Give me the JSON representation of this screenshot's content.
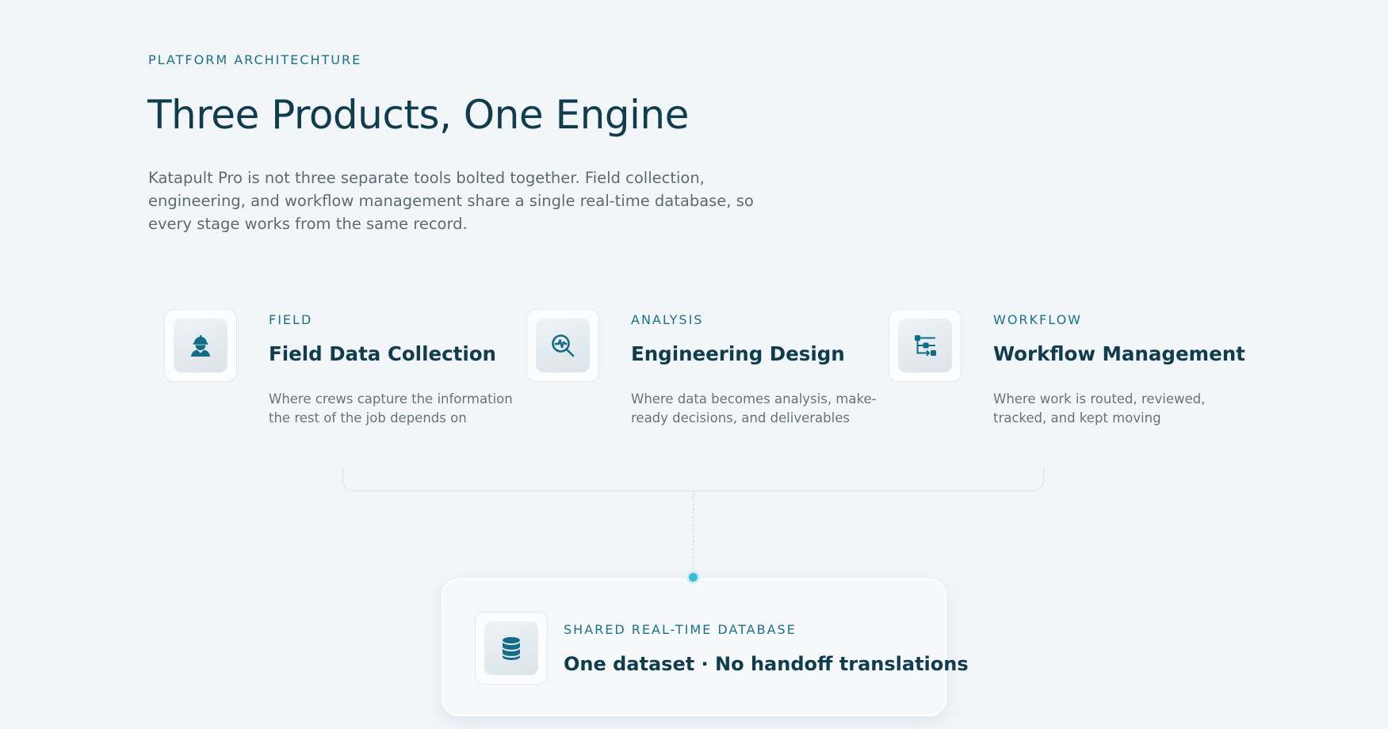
{
  "header": {
    "eyebrow": "PLATFORM ARCHITECHTURE",
    "title": "Three Products, One Engine",
    "intro": "Katapult Pro is not three separate tools bolted together. Field collection, engineering, and workflow management share a single real-time database, so every stage works from the same record."
  },
  "products": [
    {
      "tag": "FIELD",
      "title": "Field Data Collection",
      "description": "Where crews capture the information the rest of the job depends on",
      "icon": "worker-hardhat-icon"
    },
    {
      "tag": "ANALYSIS",
      "title": "Engineering Design",
      "description": "Where data becomes analysis, make-ready decisions, and deliverables",
      "icon": "analysis-magnifier-icon"
    },
    {
      "tag": "WORKFLOW",
      "title": "Workflow Management",
      "description": "Where work is routed, reviewed, tracked, and kept moving",
      "icon": "workflow-flowchart-icon"
    }
  ],
  "database": {
    "tag": "SHARED REAL-TIME DATABASE",
    "title": "One dataset · No handoff translations",
    "icon": "database-icon"
  },
  "colors": {
    "background": "#f3f6f9",
    "heading": "#0f3d4d",
    "accent": "#1a7289",
    "icon": "#136b85",
    "connector_dot": "#3bbcd8",
    "body_text": "#5d6a72"
  }
}
